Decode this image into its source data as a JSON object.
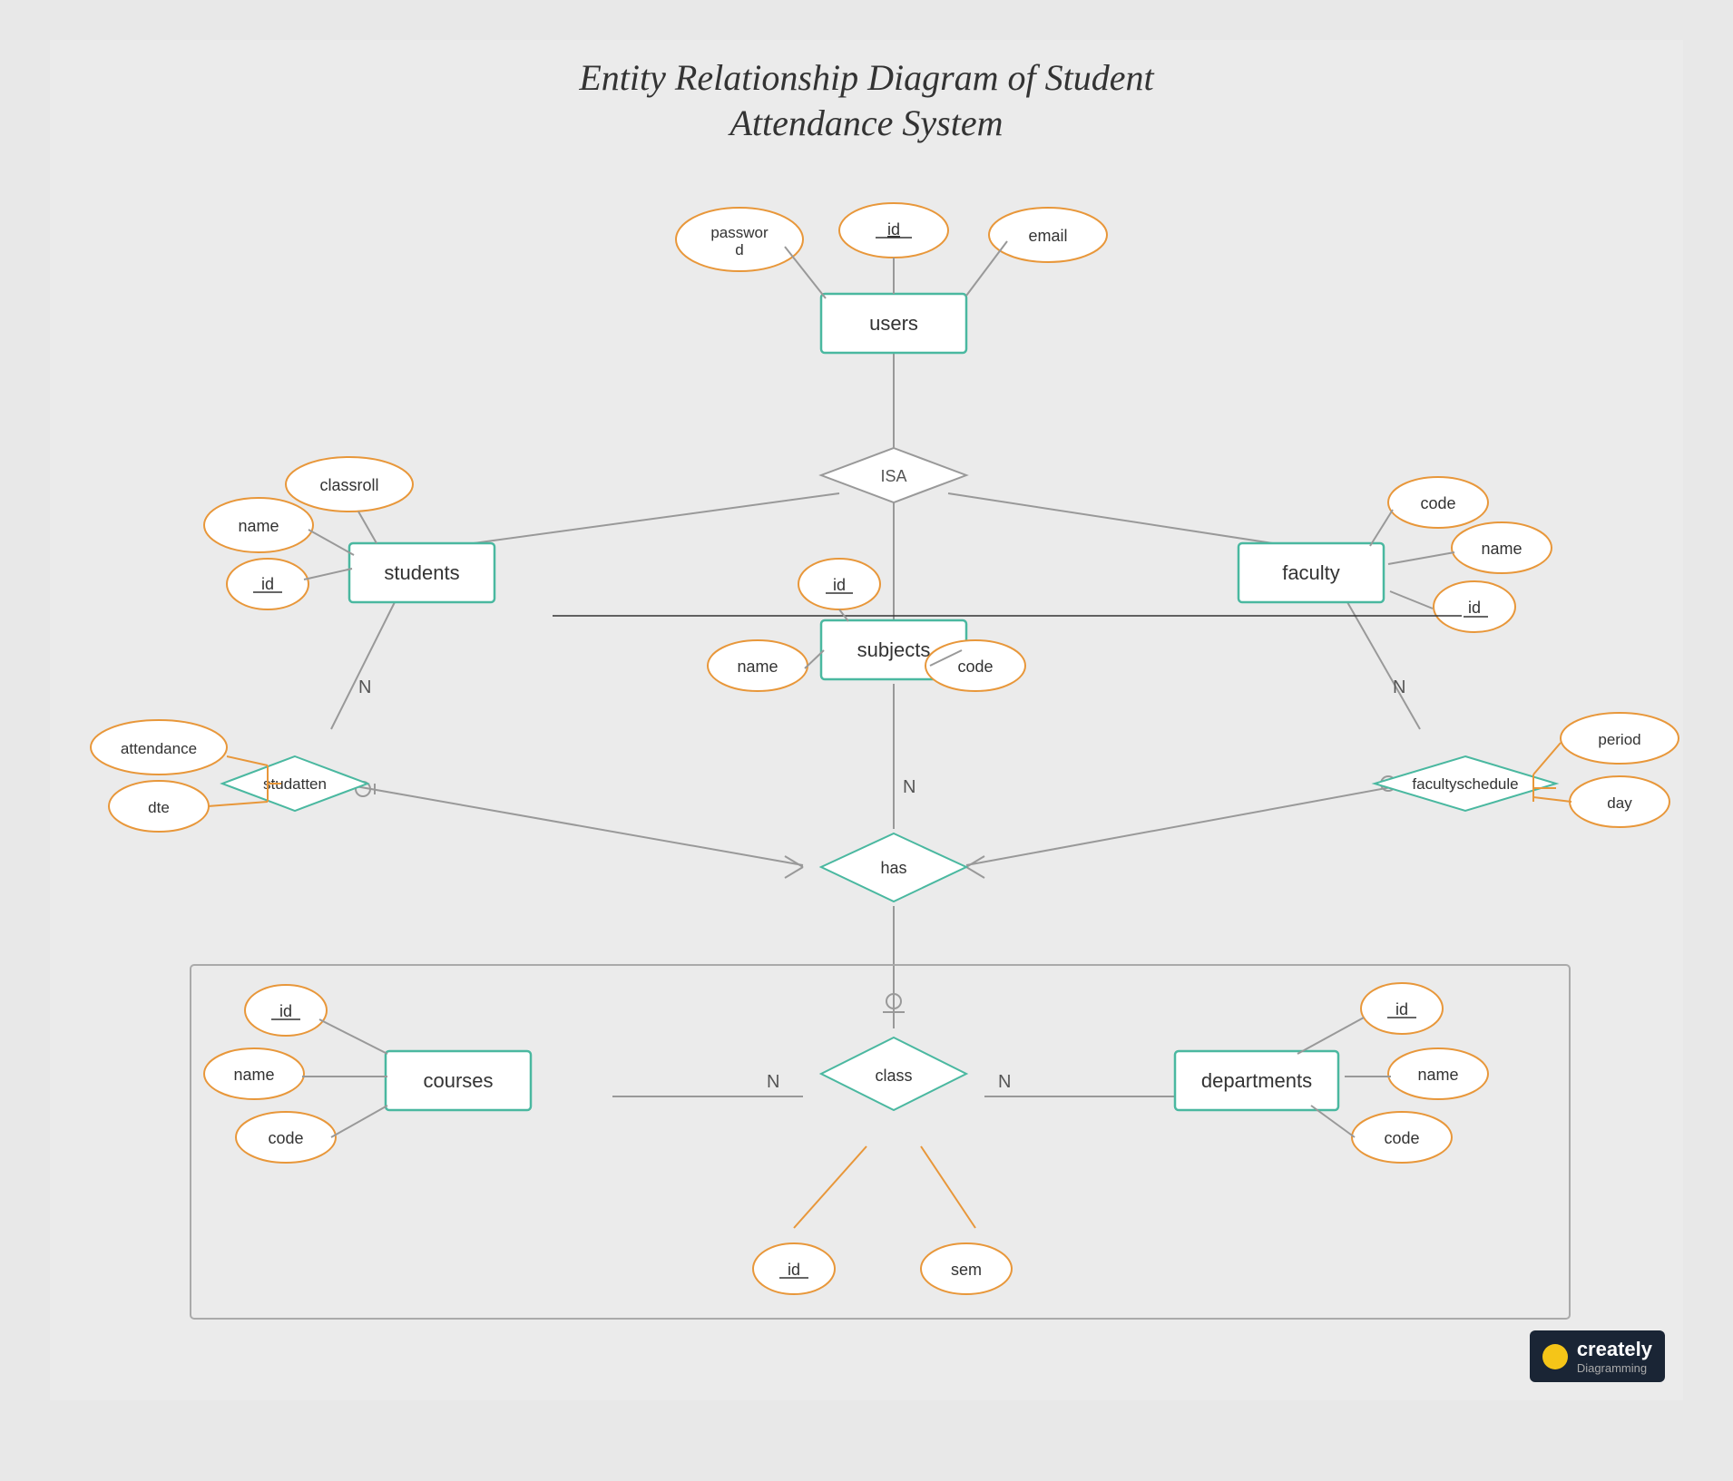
{
  "title": {
    "line1": "Entity Relationship Diagram of Student",
    "line2": "Attendance System"
  },
  "entities": {
    "users": "users",
    "students": "students",
    "faculty": "faculty",
    "subjects": "subjects",
    "courses": "courses",
    "departments": "departments",
    "class": "class"
  },
  "relationships": {
    "isa": "ISA",
    "studatten": "studatten",
    "facultyschedule": "facultyschedule",
    "has": "has"
  },
  "attributes": {
    "users_id": "id",
    "users_password": "password",
    "users_email": "email",
    "students_name": "name",
    "students_classroll": "classroll",
    "students_id": "id",
    "faculty_code": "code",
    "faculty_name": "name",
    "faculty_id": "id",
    "subjects_id": "id",
    "subjects_name": "name",
    "subjects_code": "code",
    "studatten_attendance": "attendance",
    "studatten_dte": "dte",
    "facultyschedule_period": "period",
    "facultyschedule_day": "day",
    "courses_id": "id",
    "courses_name": "name",
    "courses_code": "code",
    "departments_id": "id",
    "departments_name": "name",
    "departments_code": "code",
    "class_id": "id",
    "class_sem": "sem"
  },
  "watermark": {
    "brand": "creately",
    "sub": "Diagramming"
  }
}
